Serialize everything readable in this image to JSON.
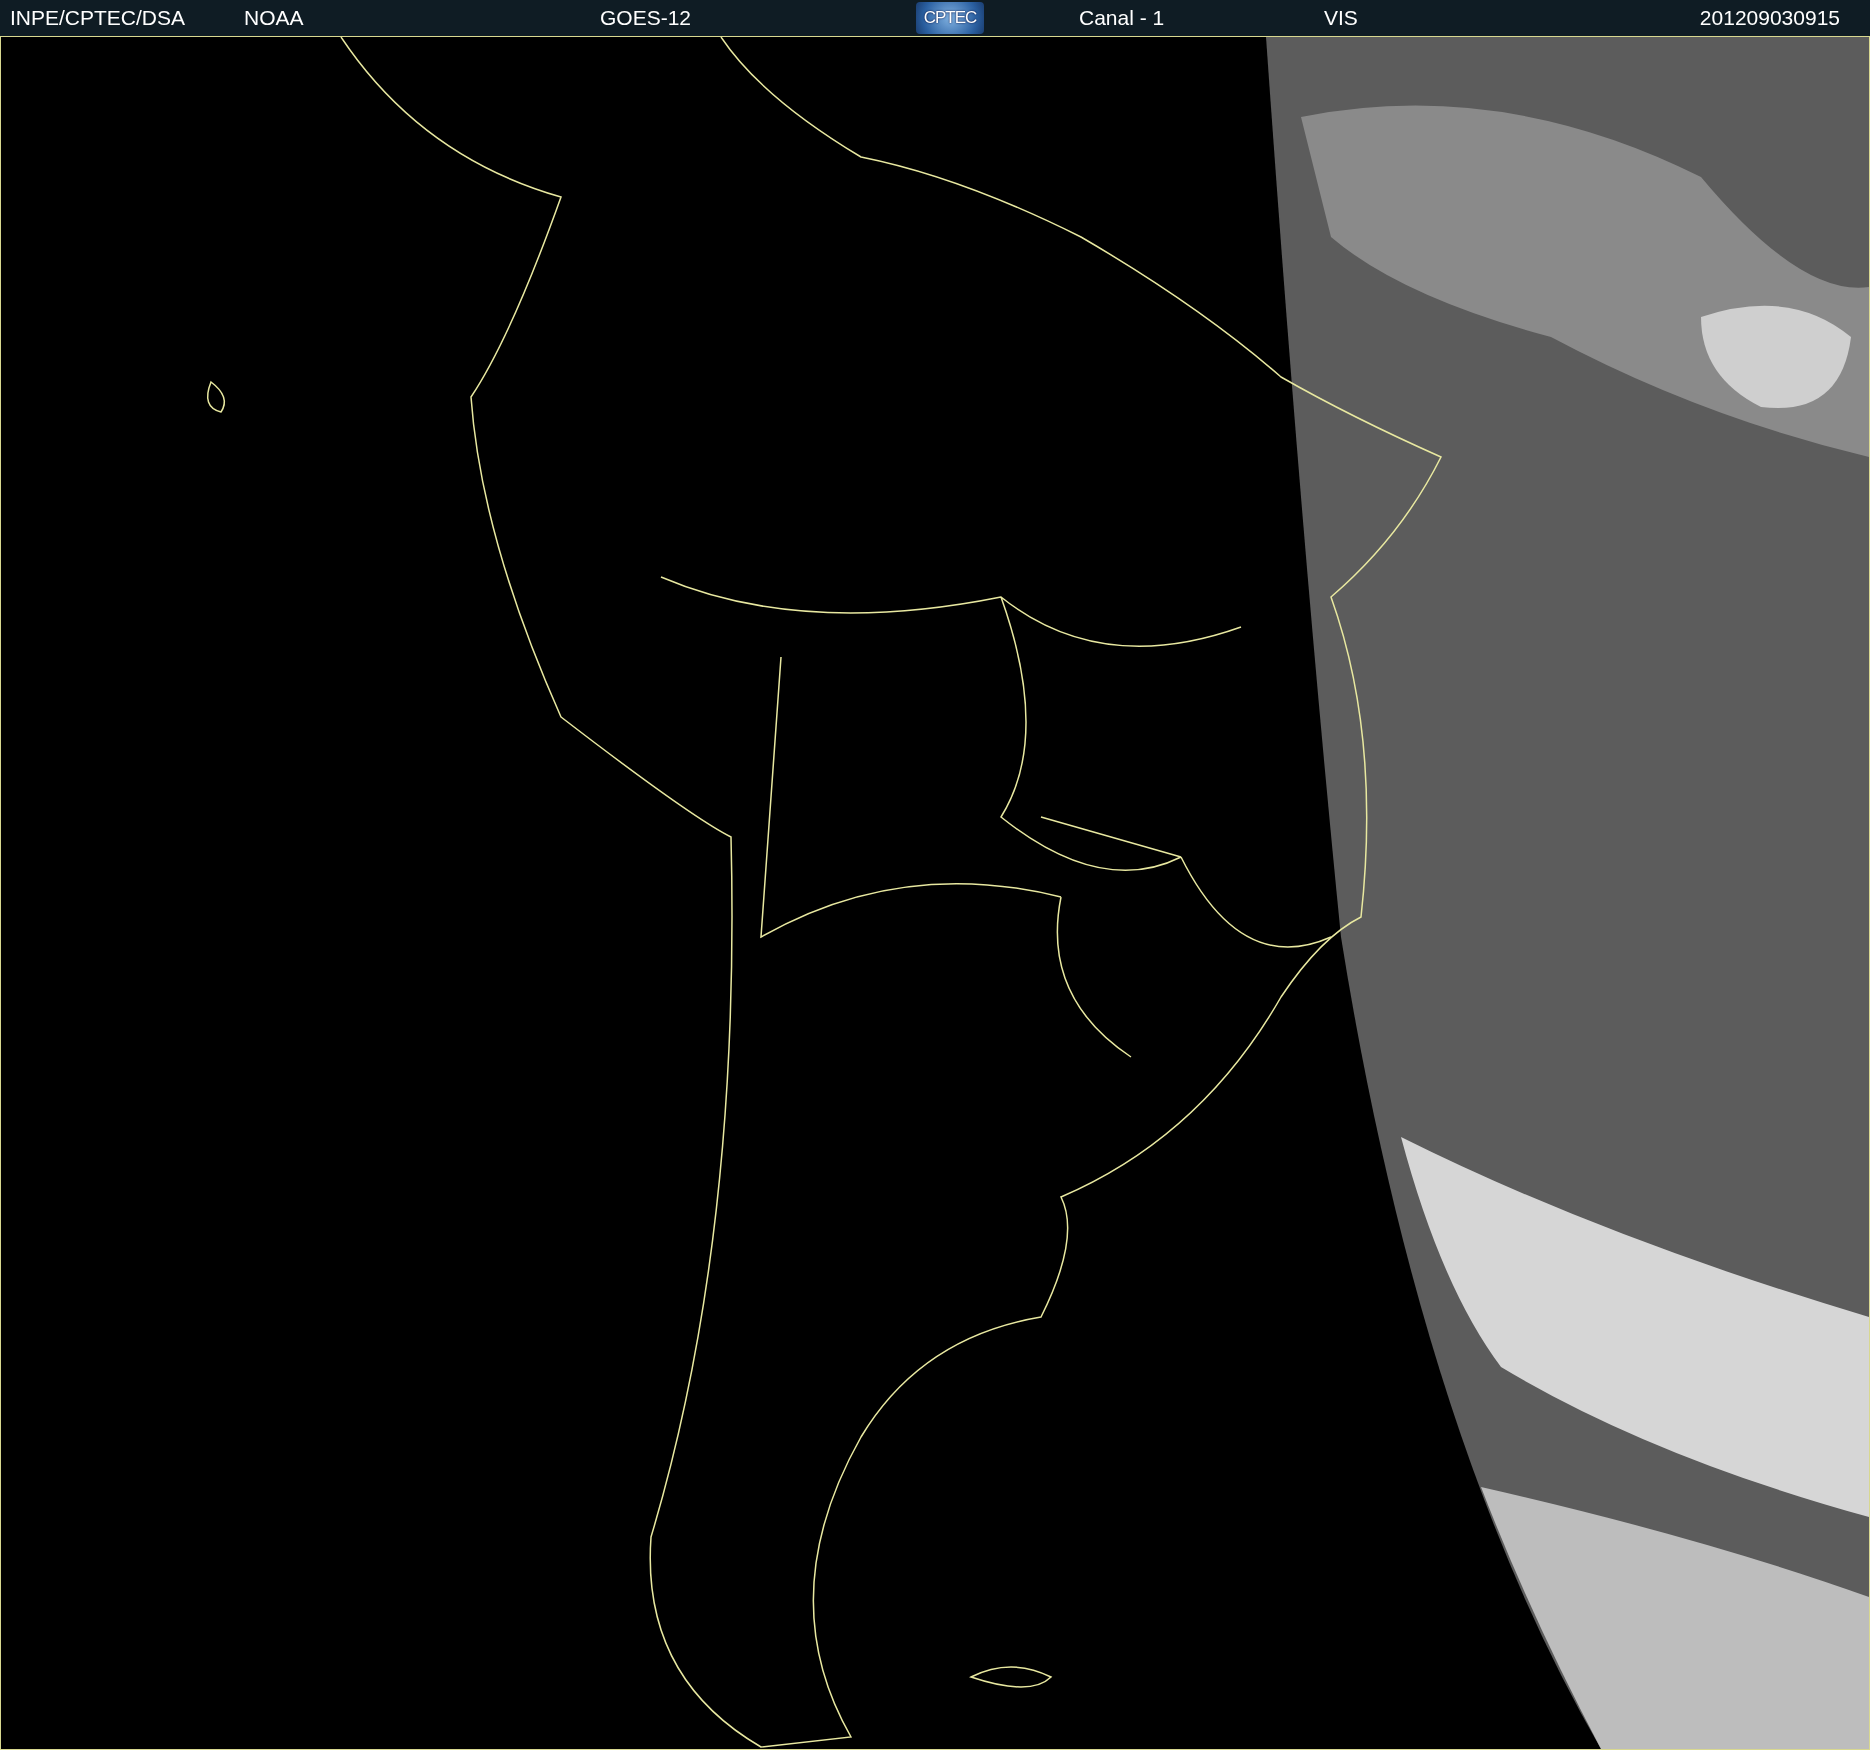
{
  "header": {
    "agency": "INPE/CPTEC/DSA",
    "source": "NOAA",
    "satellite": "GOES-12",
    "logo": "CPTEC",
    "channel": "Canal - 1",
    "band": "VIS",
    "timestamp": "201209030915"
  }
}
